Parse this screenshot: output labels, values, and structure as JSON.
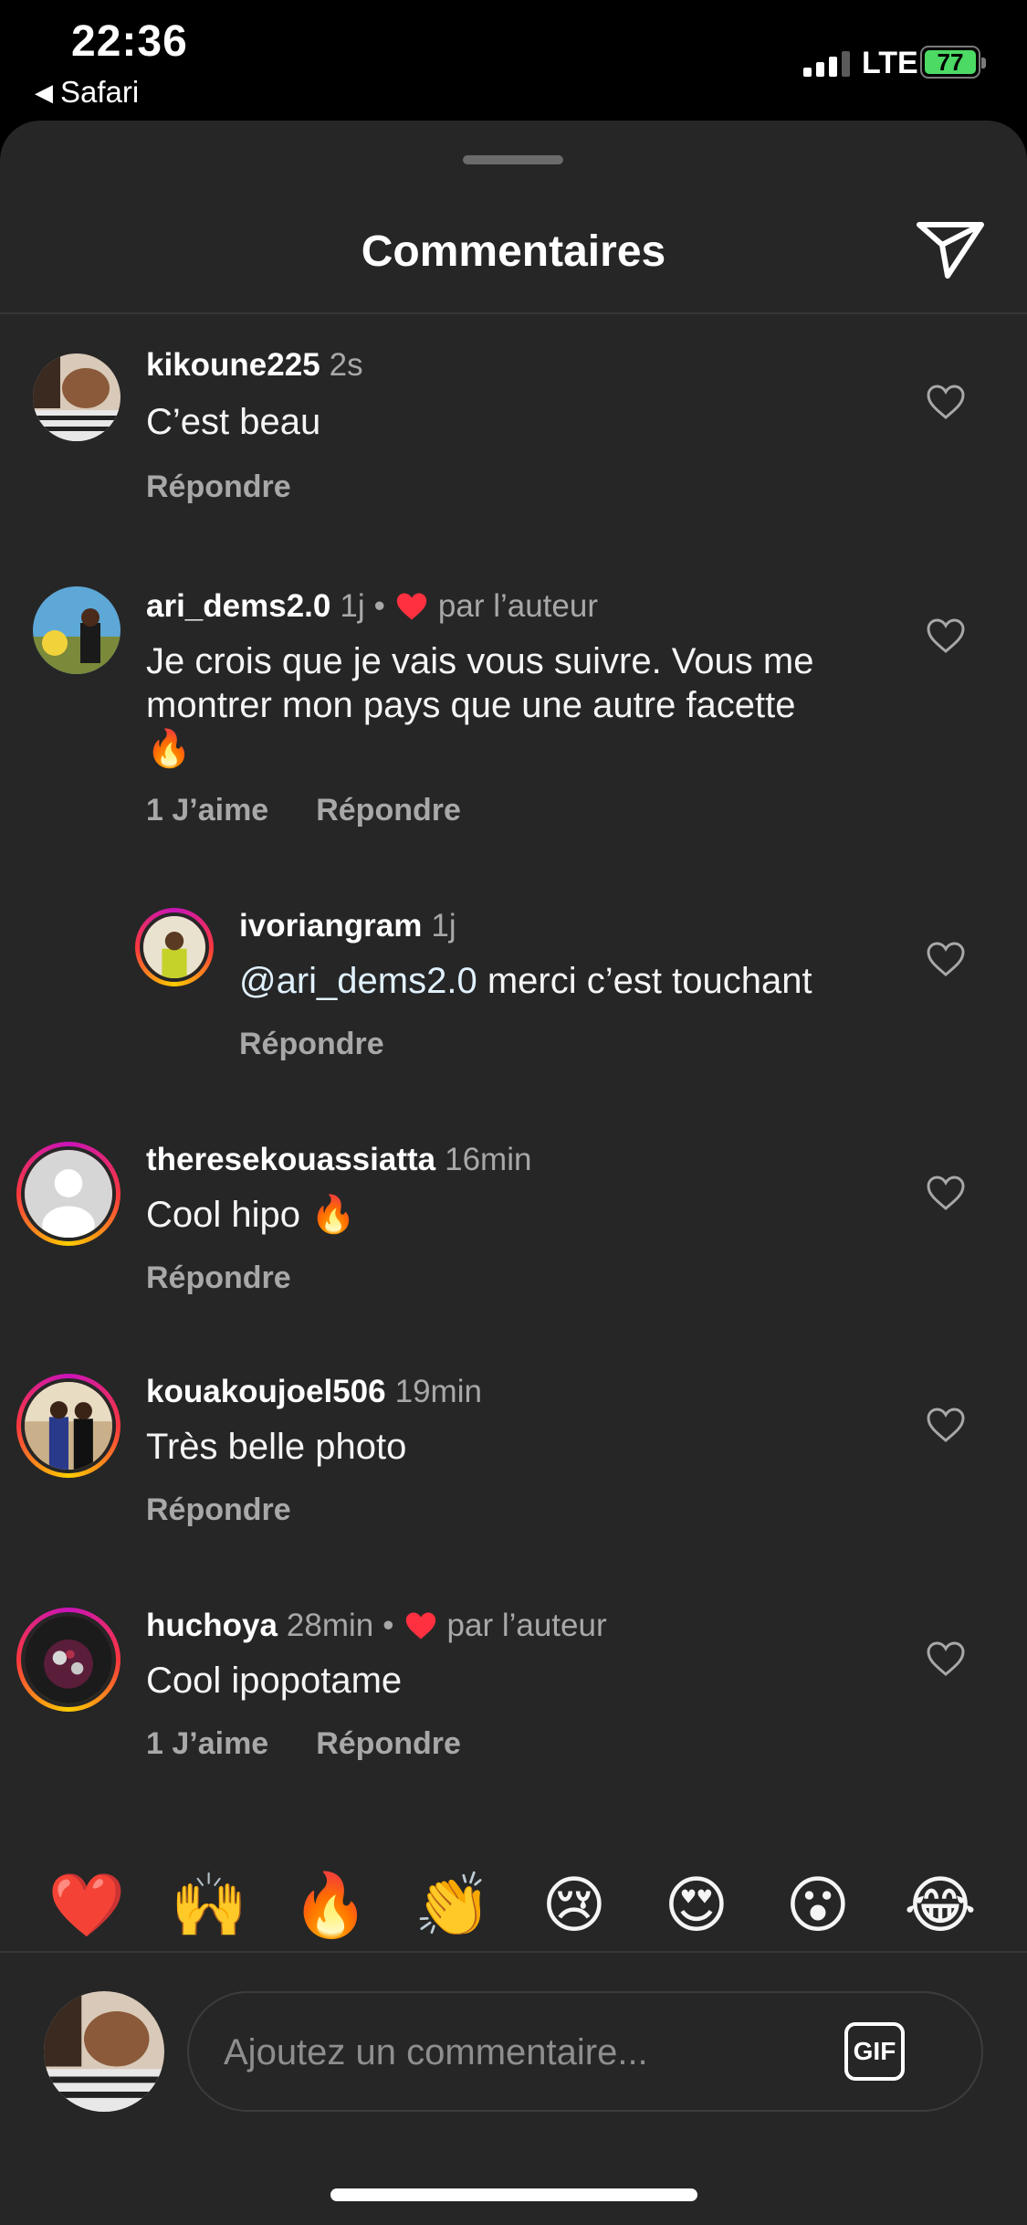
{
  "status_bar": {
    "time": "22:36",
    "back_app": "Safari",
    "network": "LTE",
    "battery": "77"
  },
  "header": {
    "title": "Commentaires"
  },
  "comments": [
    {
      "username": "kikoune225",
      "time": "2s",
      "text": "C’est beau",
      "reply": "Répondre"
    },
    {
      "username": "ari_dems2.0",
      "time": "1j",
      "liked_by_author": "par l’auteur",
      "text_line1": "Je crois que je vais vous suivre. Vous me",
      "text_line2": "montrer mon pays que une autre facette",
      "text_line3": "🔥",
      "likes": "1 J’aime",
      "reply": "Répondre"
    },
    {
      "username": "ivoriangram",
      "time": "1j",
      "mention": "@ari_dems2.0",
      "text": " merci c’est touchant",
      "reply": "Répondre"
    },
    {
      "username": "theresekouassiatta",
      "time": "16min",
      "text": "Cool hipo 🔥",
      "reply": "Répondre"
    },
    {
      "username": "kouakoujoel506",
      "time": "19min",
      "text": "Très belle photo",
      "reply": "Répondre"
    },
    {
      "username": "huchoya",
      "time": "28min",
      "liked_by_author": "par l’auteur",
      "text": "Cool ipopotame",
      "likes": "1 J’aime",
      "reply": "Répondre"
    }
  ],
  "reactions": [
    "❤️",
    "🙌",
    "🔥",
    "👏",
    "😢",
    "😍",
    "😮",
    "😂"
  ],
  "composer": {
    "placeholder": "Ajoutez un commentaire...",
    "gif_label": "GIF"
  },
  "colors": {
    "background": "#262626",
    "heart_red": "#ff3040",
    "muted_text": "#a8a8a8",
    "battery_green": "#4cd964"
  }
}
